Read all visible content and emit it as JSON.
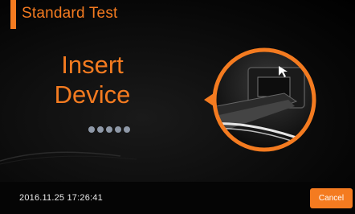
{
  "header": {
    "title": "Standard Test"
  },
  "main": {
    "instruction_line1": "Insert",
    "instruction_line2": "Device",
    "progress_dots": 5,
    "illustration_icon": "device-insert-illustration-icon"
  },
  "footer": {
    "datetime": "2016.11.25 17:26:41",
    "cancel_label": "Cancel"
  },
  "colors": {
    "accent": "#f47b20",
    "background": "#000000",
    "dots": "#8f99a8"
  }
}
